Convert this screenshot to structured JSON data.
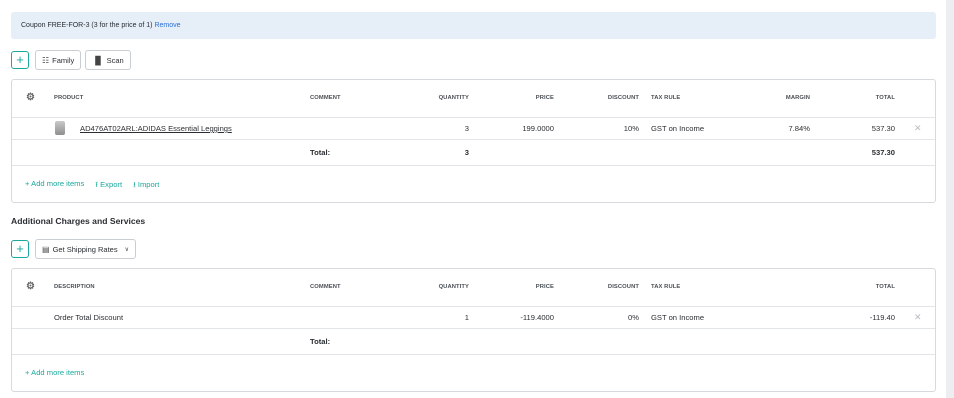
{
  "coupon": {
    "text": "Coupon FREE-FOR-3 (3 for the price of 1)",
    "remove_label": "Remove"
  },
  "items_toolbar": {
    "add_symbol": "+",
    "family_label": "Family",
    "scan_label": "Scan"
  },
  "items_table": {
    "headers": {
      "product": "PRODUCT",
      "comment": "COMMENT",
      "quantity": "QUANTITY",
      "price": "PRICE",
      "discount": "DISCOUNT",
      "tax_rule": "TAX RULE",
      "margin": "MARGIN",
      "total": "TOTAL"
    },
    "rows": [
      {
        "product": "AD476AT02ARL:ADIDAS Essential Leggings",
        "quantity": "3",
        "price": "199.0000",
        "discount": "10%",
        "tax_rule": "GST on Income",
        "margin": "7.84%",
        "total": "537.30"
      }
    ],
    "totals": {
      "label": "Total:",
      "quantity": "3",
      "total": "537.30"
    },
    "footer": {
      "add_more": "+ Add more items",
      "export": "Export",
      "import": "Import"
    }
  },
  "charges_section": {
    "title": "Additional Charges and Services"
  },
  "charges_toolbar": {
    "add_symbol": "+",
    "shipping_label": "Get Shipping Rates"
  },
  "charges_table": {
    "headers": {
      "description": "DESCRIPTION",
      "comment": "COMMENT",
      "quantity": "QUANTITY",
      "price": "PRICE",
      "discount": "DISCOUNT",
      "tax_rule": "TAX RULE",
      "total": "TOTAL"
    },
    "rows": [
      {
        "description": "Order Total Discount",
        "quantity": "1",
        "price": "-119.4000",
        "discount": "0%",
        "tax_rule": "GST on Income",
        "total": "-119.40"
      }
    ],
    "totals": {
      "label": "Total:"
    },
    "footer": {
      "add_more": "+ Add more items"
    }
  },
  "colors": {
    "accent": "#1aa89c",
    "link": "#2a6fd6",
    "coupon_bg": "#e6eef8"
  },
  "icons": [
    "gear-icon",
    "family-icon",
    "barcode-icon",
    "close-icon",
    "export-icon",
    "import-icon",
    "calendar-icon",
    "chevron-down-icon"
  ]
}
